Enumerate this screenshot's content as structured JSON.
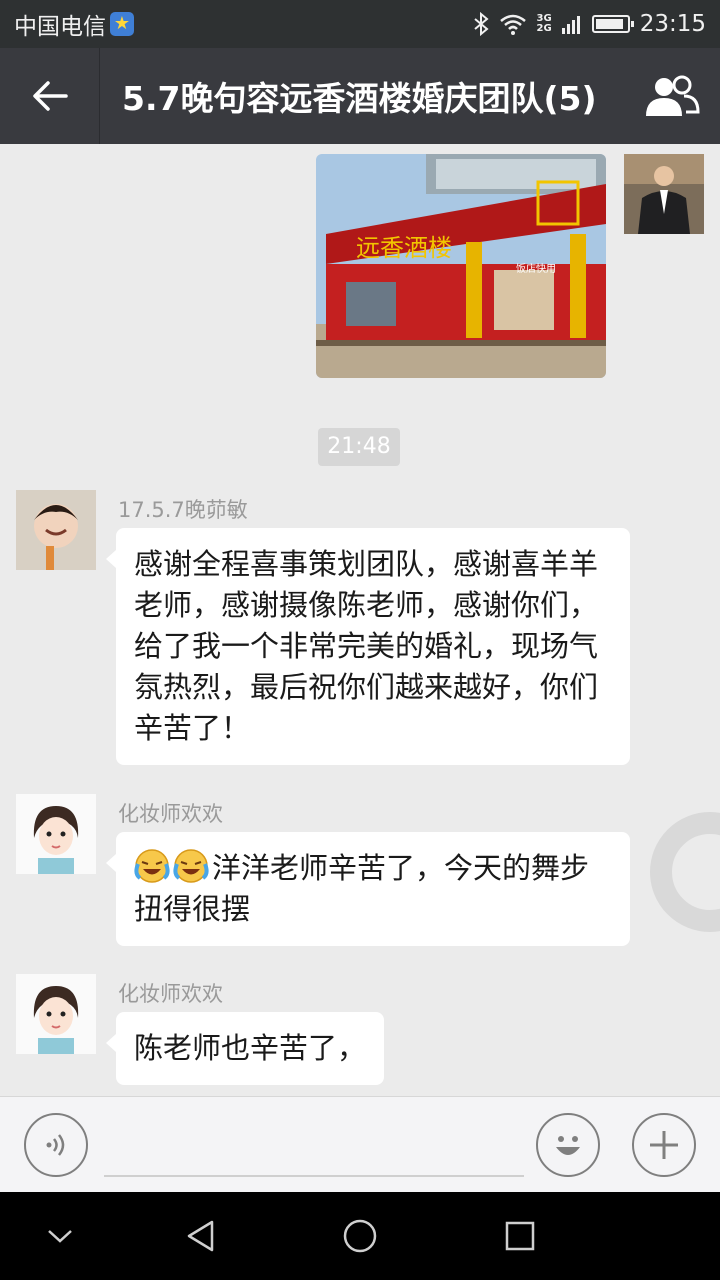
{
  "status_bar": {
    "carrier": "中国电信",
    "network_top": "3G",
    "network_bottom": "2G",
    "time": "23:15",
    "battery_level": 0.9
  },
  "header": {
    "title": "5.7晚句容远香酒楼婚庆团队(5)"
  },
  "chat": {
    "photo_sign": "远香酒楼",
    "photo_small_sign": "饭店快用",
    "timestamp": "21:48",
    "messages": [
      {
        "sender": "17.5.7晚茆敏",
        "text": "感谢全程喜事策划团队，感谢喜羊羊老师，感谢摄像陈老师，感谢你们，给了我一个非常完美的婚礼，现场气氛热烈，最后祝你们越来越好，你们辛苦了！"
      },
      {
        "sender": "化妆师欢欢",
        "text": "洋洋老师辛苦了，今天的舞步扭得很摆",
        "emoji": [
          "crying-laugh-emoji",
          "crying-laugh-emoji"
        ]
      },
      {
        "sender": "化妆师欢欢",
        "text": "陈老师也辛苦了，"
      }
    ]
  },
  "colors": {
    "title_bar": "#393a3f",
    "status_bar": "#2e3132",
    "chat_bg": "#ebebeb",
    "bubble": "#ffffff"
  }
}
